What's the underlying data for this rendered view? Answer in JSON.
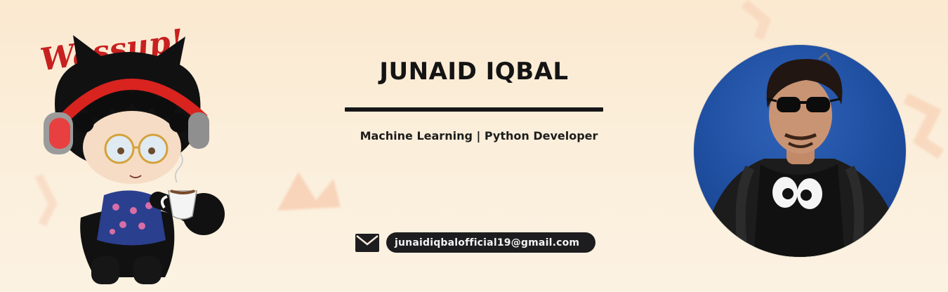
{
  "banner": {
    "greeting": "Wassup!",
    "name": "JUNAID IQBAL",
    "subtitle": "Machine Learning | Python Developer",
    "email": "junaidiqbalofficial19@gmail.com"
  },
  "icons": {
    "mail": "mail-icon",
    "mascot": "octocat-mascot",
    "avatar": "profile-photo"
  },
  "colors": {
    "background": "#fbe9d0",
    "text": "#141414",
    "pill": "#1d1c1e",
    "greeting": "#c8201f",
    "avatar_bg": "#1e4d9e"
  }
}
